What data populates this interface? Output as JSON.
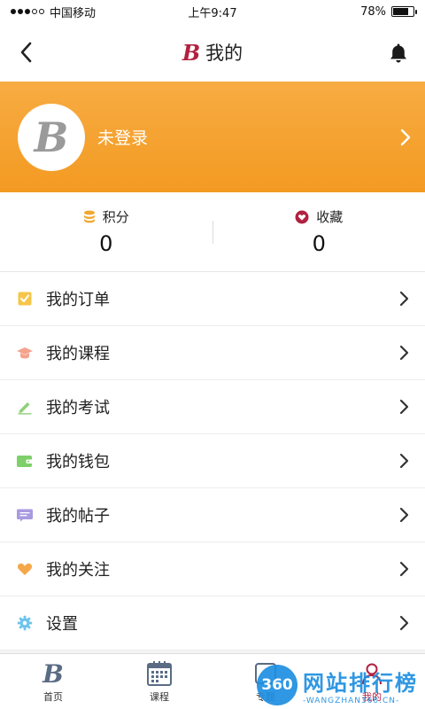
{
  "status_bar": {
    "carrier": "中国移动",
    "time": "上午9:47",
    "battery_percent": "78%",
    "battery_level": 0.78
  },
  "nav": {
    "logo_letter": "B",
    "title": "我的"
  },
  "profile": {
    "avatar_letter": "B",
    "name": "未登录"
  },
  "stats": [
    {
      "label": "积分",
      "value": "0",
      "icon": "coins-icon",
      "color": "#f0a830"
    },
    {
      "label": "收藏",
      "value": "0",
      "icon": "heart-icon",
      "color": "#b22140"
    }
  ],
  "menu": [
    {
      "label": "我的订单",
      "icon": "order-icon",
      "color": "#f5c64a"
    },
    {
      "label": "我的课程",
      "icon": "graduation-cap-icon",
      "color": "#f4a38e"
    },
    {
      "label": "我的考试",
      "icon": "pencil-icon",
      "color": "#8fd07a"
    },
    {
      "label": "我的钱包",
      "icon": "wallet-icon",
      "color": "#7fcf6a"
    },
    {
      "label": "我的帖子",
      "icon": "message-icon",
      "color": "#a99ae0"
    },
    {
      "label": "我的关注",
      "icon": "heart-icon",
      "color": "#f5a84a"
    },
    {
      "label": "设置",
      "icon": "gear-icon",
      "color": "#6ec4ec"
    }
  ],
  "tabs": [
    {
      "label": "首页",
      "icon": "home-logo-icon"
    },
    {
      "label": "课程",
      "icon": "calendar-icon"
    },
    {
      "label": "专题",
      "icon": "topic-icon"
    },
    {
      "label": "我的",
      "icon": "profile-icon",
      "active": true
    }
  ],
  "watermark": {
    "badge": "360",
    "title": "网站排行榜",
    "subtitle": "-WANGZHAN360.CN-"
  },
  "colors": {
    "banner": "#f39a22",
    "brand": "#b22140",
    "accent_blue": "#1e8fe1"
  }
}
